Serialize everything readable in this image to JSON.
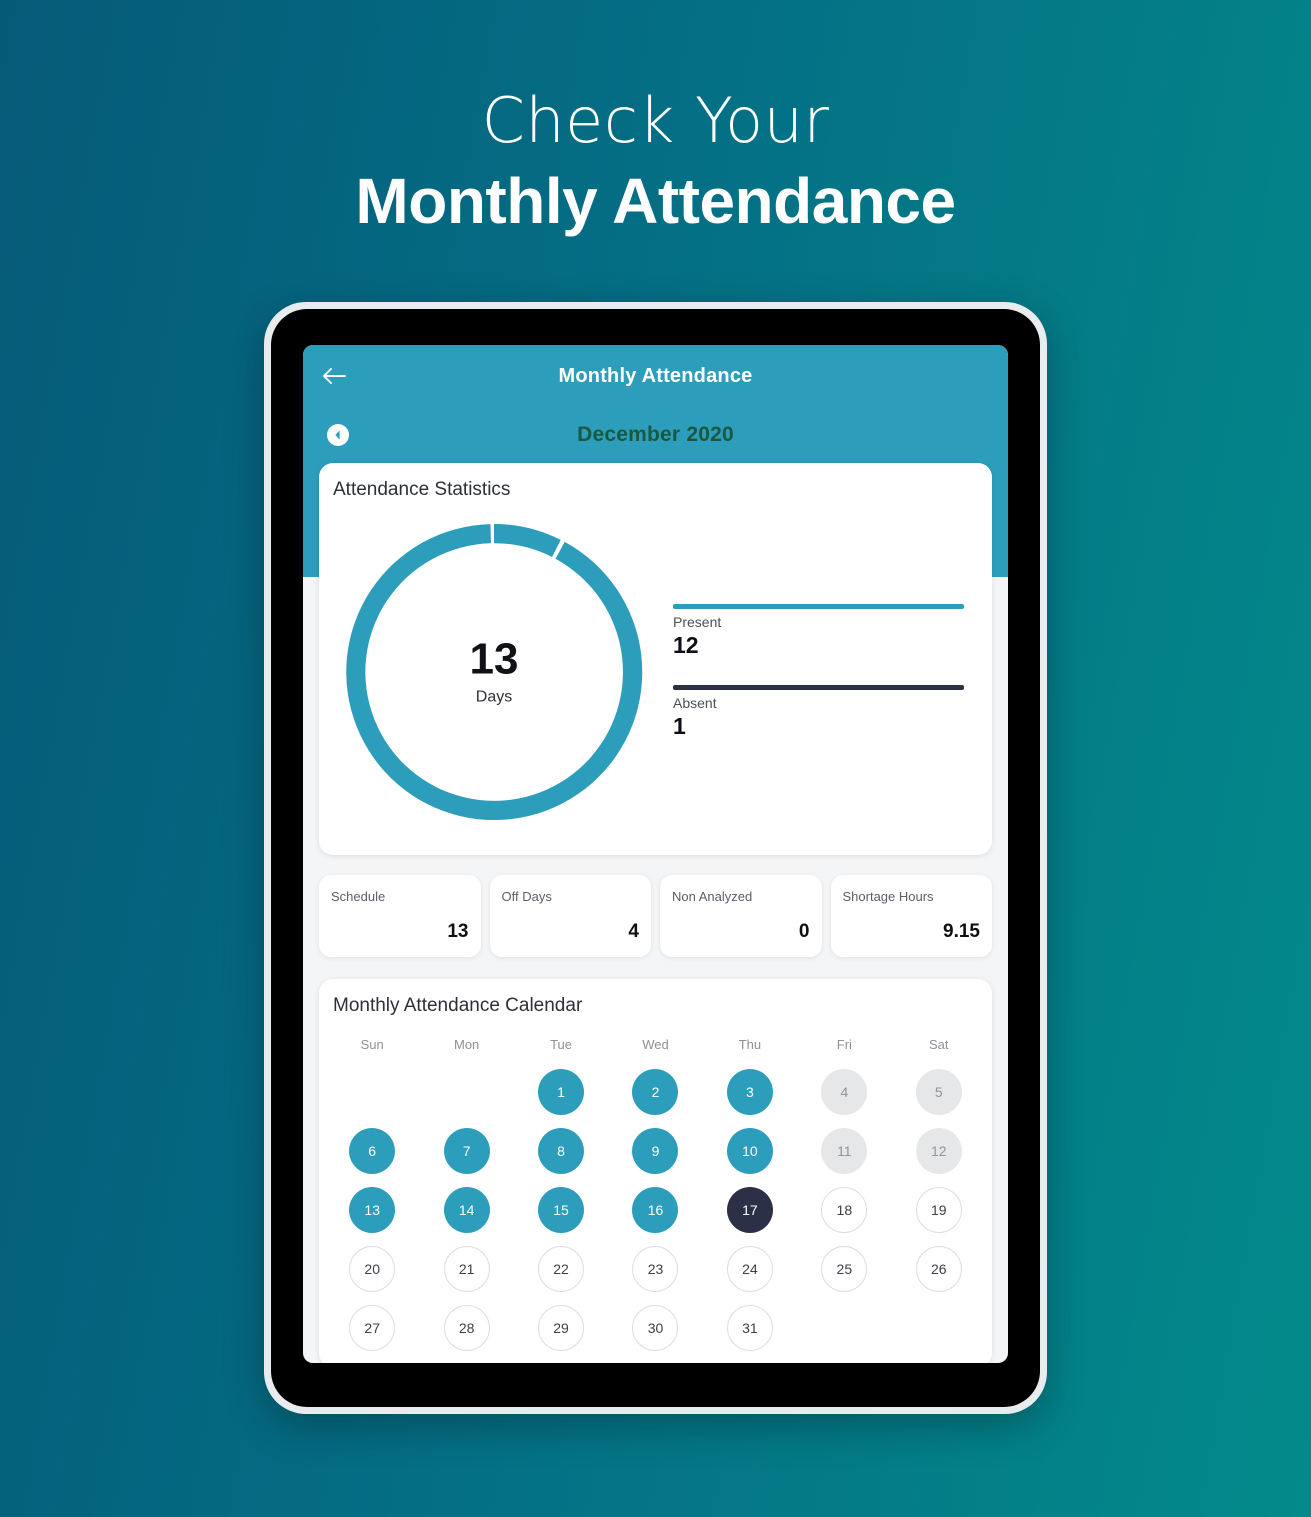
{
  "promo": {
    "line1": "Check Your",
    "line2": "Monthly Attendance"
  },
  "colors": {
    "bg_gradient_start": "#055a78",
    "bg_gradient_end": "#038a8a",
    "app_accent": "#2c9ebc",
    "absent_dark": "#2b3047",
    "month_text": "#1a5940",
    "screen_bg": "#f4f5f7",
    "offday_gray": "#e6e7e8"
  },
  "app": {
    "back_icon": "arrow-left-icon",
    "title": "Monthly Attendance",
    "prev_month_icon": "chevron-left-icon",
    "month_label": "December 2020"
  },
  "stats": {
    "card_title": "Attendance Statistics",
    "center_value": "13",
    "center_unit": "Days",
    "legend": [
      {
        "label": "Present",
        "value": "12",
        "color": "#2c9ebc"
      },
      {
        "label": "Absent",
        "value": "1",
        "color": "#2b3047"
      }
    ]
  },
  "kpis": [
    {
      "label": "Schedule",
      "value": "13"
    },
    {
      "label": "Off Days",
      "value": "4"
    },
    {
      "label": "Non Analyzed",
      "value": "0"
    },
    {
      "label": "Shortage Hours",
      "value": "9.15"
    }
  ],
  "calendar": {
    "card_title": "Monthly Attendance Calendar",
    "weekdays": [
      "Sun",
      "Mon",
      "Tue",
      "Wed",
      "Thu",
      "Fri",
      "Sat"
    ],
    "cells": [
      {
        "label": "",
        "state": "empty"
      },
      {
        "label": "",
        "state": "empty"
      },
      {
        "label": "1",
        "state": "present"
      },
      {
        "label": "2",
        "state": "present"
      },
      {
        "label": "3",
        "state": "present"
      },
      {
        "label": "4",
        "state": "off"
      },
      {
        "label": "5",
        "state": "off"
      },
      {
        "label": "6",
        "state": "present"
      },
      {
        "label": "7",
        "state": "present"
      },
      {
        "label": "8",
        "state": "present"
      },
      {
        "label": "9",
        "state": "present"
      },
      {
        "label": "10",
        "state": "present"
      },
      {
        "label": "11",
        "state": "off"
      },
      {
        "label": "12",
        "state": "off"
      },
      {
        "label": "13",
        "state": "present"
      },
      {
        "label": "14",
        "state": "present"
      },
      {
        "label": "15",
        "state": "present"
      },
      {
        "label": "16",
        "state": "present"
      },
      {
        "label": "17",
        "state": "today"
      },
      {
        "label": "18",
        "state": "plain"
      },
      {
        "label": "19",
        "state": "plain"
      },
      {
        "label": "20",
        "state": "plain"
      },
      {
        "label": "21",
        "state": "plain"
      },
      {
        "label": "22",
        "state": "plain"
      },
      {
        "label": "23",
        "state": "plain"
      },
      {
        "label": "24",
        "state": "plain"
      },
      {
        "label": "25",
        "state": "plain"
      },
      {
        "label": "26",
        "state": "plain"
      },
      {
        "label": "27",
        "state": "plain"
      },
      {
        "label": "28",
        "state": "plain"
      },
      {
        "label": "29",
        "state": "plain"
      },
      {
        "label": "30",
        "state": "plain"
      },
      {
        "label": "31",
        "state": "plain"
      },
      {
        "label": "",
        "state": "empty"
      },
      {
        "label": "",
        "state": "empty"
      }
    ]
  },
  "chart_data": {
    "type": "pie",
    "title": "Attendance Statistics",
    "categories": [
      "Present",
      "Absent"
    ],
    "values": [
      12,
      1
    ],
    "colors": [
      "#2c9ebc",
      "#2c9ebc"
    ],
    "total": 13,
    "center_label": "13 Days",
    "legend_position": "right",
    "donut": true,
    "inner_radius_ratio": 0.82,
    "segment_gap_deg": 2
  }
}
